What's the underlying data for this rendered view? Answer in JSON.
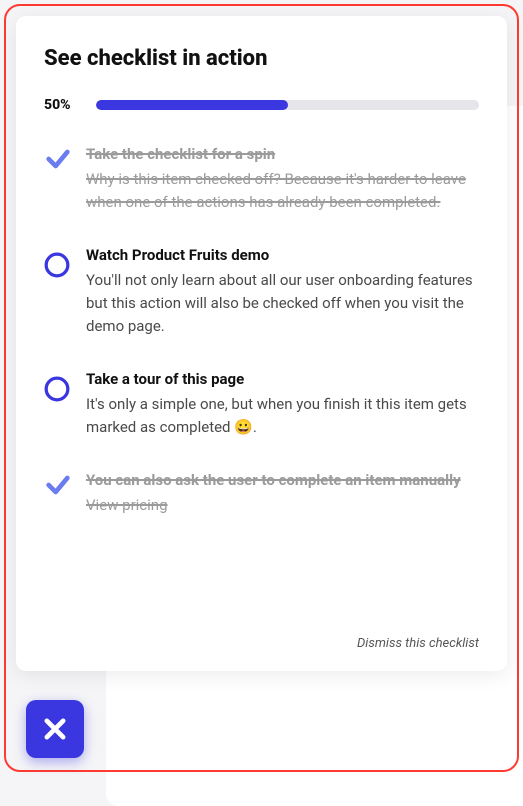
{
  "title": "See checklist in action",
  "progress": {
    "label": "50%",
    "value": 50
  },
  "items": [
    {
      "completed": true,
      "title": "Take the checklist for a spin",
      "desc": "Why is this item checked off? Because it's harder to leave when one of the actions has already been completed."
    },
    {
      "completed": false,
      "title": "Watch Product Fruits demo",
      "desc": "You'll not only learn about all our user onboarding features but this action will also be checked off when you visit the demo page."
    },
    {
      "completed": false,
      "title": "Take a tour of this page",
      "desc": "It's only a simple one, but when you finish it this item gets marked as completed 😀."
    },
    {
      "completed": true,
      "title": "You can also ask the user to complete an item manually",
      "desc": "View pricing"
    }
  ],
  "dismiss_label": "Dismiss this checklist",
  "colors": {
    "accent": "#3a36e0",
    "check": "#6a7cf0",
    "track": "#e5e5ea"
  }
}
